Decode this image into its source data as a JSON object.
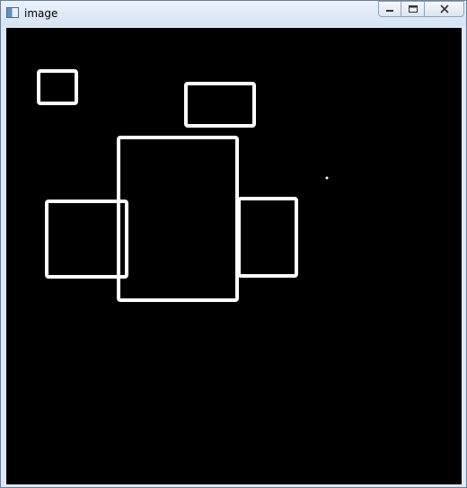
{
  "window": {
    "title": "image",
    "icon": "opencv-window-icon",
    "buttons": [
      "minimize-icon",
      "maximize-icon",
      "close-icon"
    ]
  },
  "canvas": {
    "background": "#000000",
    "stroke": "#ffffff",
    "rectangles": [
      {
        "name": "rect-small-top-left"
      },
      {
        "name": "rect-top-middle"
      },
      {
        "name": "rect-large-center"
      },
      {
        "name": "rect-left"
      },
      {
        "name": "rect-right"
      }
    ],
    "marker": "cursor-dot"
  }
}
